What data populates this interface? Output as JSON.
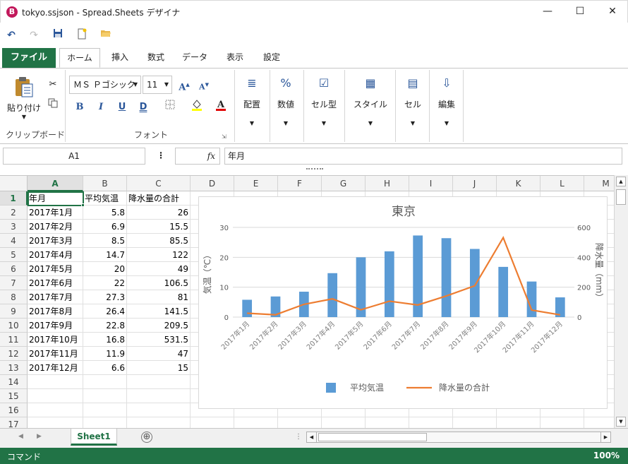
{
  "window": {
    "title": "tokyo.ssjson - Spread.Sheets デザイナ",
    "app_icon": "B",
    "controls": {
      "minimize": "—",
      "maximize": "☐",
      "close": "✕"
    }
  },
  "quick_access": {
    "undo": "↶",
    "redo": "↷",
    "save": "save-icon",
    "new": "new-file-icon",
    "open": "open-folder-icon"
  },
  "tabs": {
    "file": "ファイル",
    "items": [
      "ホーム",
      "挿入",
      "数式",
      "データ",
      "表示",
      "設定"
    ],
    "active_index": 0
  },
  "ribbon": {
    "clipboard": {
      "paste": "貼り付け",
      "label": "クリップボード"
    },
    "font": {
      "name": "ＭＳ Ｐゴシック",
      "size": "11",
      "label": "フォント",
      "bold": "B",
      "italic": "I",
      "underline": "U",
      "double_underline": "D"
    },
    "groups": [
      {
        "label": "配置",
        "icon": "≣"
      },
      {
        "label": "数値",
        "icon": "%"
      },
      {
        "label": "セル型",
        "icon": "☑"
      },
      {
        "label": "スタイル",
        "icon": "▦"
      },
      {
        "label": "セル",
        "icon": "▤"
      },
      {
        "label": "編集",
        "icon": "⇩"
      }
    ]
  },
  "formula_bar": {
    "name_box": "A1",
    "separator": "⋮",
    "fx": "fx",
    "value": "年月"
  },
  "grid": {
    "columns": [
      "A",
      "B",
      "C",
      "D",
      "E",
      "F",
      "G",
      "H",
      "I",
      "J",
      "K",
      "L",
      "M"
    ],
    "rows": [
      "1",
      "2",
      "3",
      "4",
      "5",
      "6",
      "7",
      "8",
      "9",
      "10",
      "11",
      "12",
      "13",
      "14",
      "15",
      "16",
      "17"
    ],
    "header": [
      "年月",
      "平均気温",
      "降水量の合計"
    ],
    "data": [
      [
        "2017年1月",
        "5.8",
        "26"
      ],
      [
        "2017年2月",
        "6.9",
        "15.5"
      ],
      [
        "2017年3月",
        "8.5",
        "85.5"
      ],
      [
        "2017年4月",
        "14.7",
        "122"
      ],
      [
        "2017年5月",
        "20",
        "49"
      ],
      [
        "2017年6月",
        "22",
        "106.5"
      ],
      [
        "2017年7月",
        "27.3",
        "81"
      ],
      [
        "2017年8月",
        "26.4",
        "141.5"
      ],
      [
        "2017年9月",
        "22.8",
        "209.5"
      ],
      [
        "2017年10月",
        "16.8",
        "531.5"
      ],
      [
        "2017年11月",
        "11.9",
        "47"
      ],
      [
        "2017年12月",
        "6.6",
        "15"
      ]
    ]
  },
  "chart_data": {
    "type": "bar",
    "title": "東京",
    "categories": [
      "2017年1月",
      "2017年2月",
      "2017年3月",
      "2017年4月",
      "2017年5月",
      "2017年6月",
      "2017年7月",
      "2017年8月",
      "2017年9月",
      "2017年10月",
      "2017年11月",
      "2017年12月"
    ],
    "series": [
      {
        "name": "平均気温",
        "type": "bar",
        "axis": "left",
        "values": [
          5.8,
          6.9,
          8.5,
          14.7,
          20,
          22,
          27.3,
          26.4,
          22.8,
          16.8,
          11.9,
          6.6
        ],
        "color": "#5b9bd5"
      },
      {
        "name": "降水量の合計",
        "type": "line",
        "axis": "right",
        "values": [
          26,
          15.5,
          85.5,
          122,
          49,
          106.5,
          81,
          141.5,
          209.5,
          531.5,
          47,
          15
        ],
        "color": "#ed7d31"
      }
    ],
    "ylabel": "気温（℃）",
    "y2label": "降水量（mm）",
    "ylim": [
      0,
      30
    ],
    "y2lim": [
      0,
      600
    ],
    "yticks": [
      "0",
      "10",
      "20",
      "30"
    ],
    "y2ticks": [
      "0",
      "200",
      "400",
      "600"
    ],
    "legend": "bottom",
    "grid": true
  },
  "sheets": {
    "active": "Sheet1",
    "add": "⊕",
    "splitter": "⋮"
  },
  "status": {
    "mode": "コマンド",
    "zoom": "100%"
  },
  "colors": {
    "accent": "#217346"
  }
}
